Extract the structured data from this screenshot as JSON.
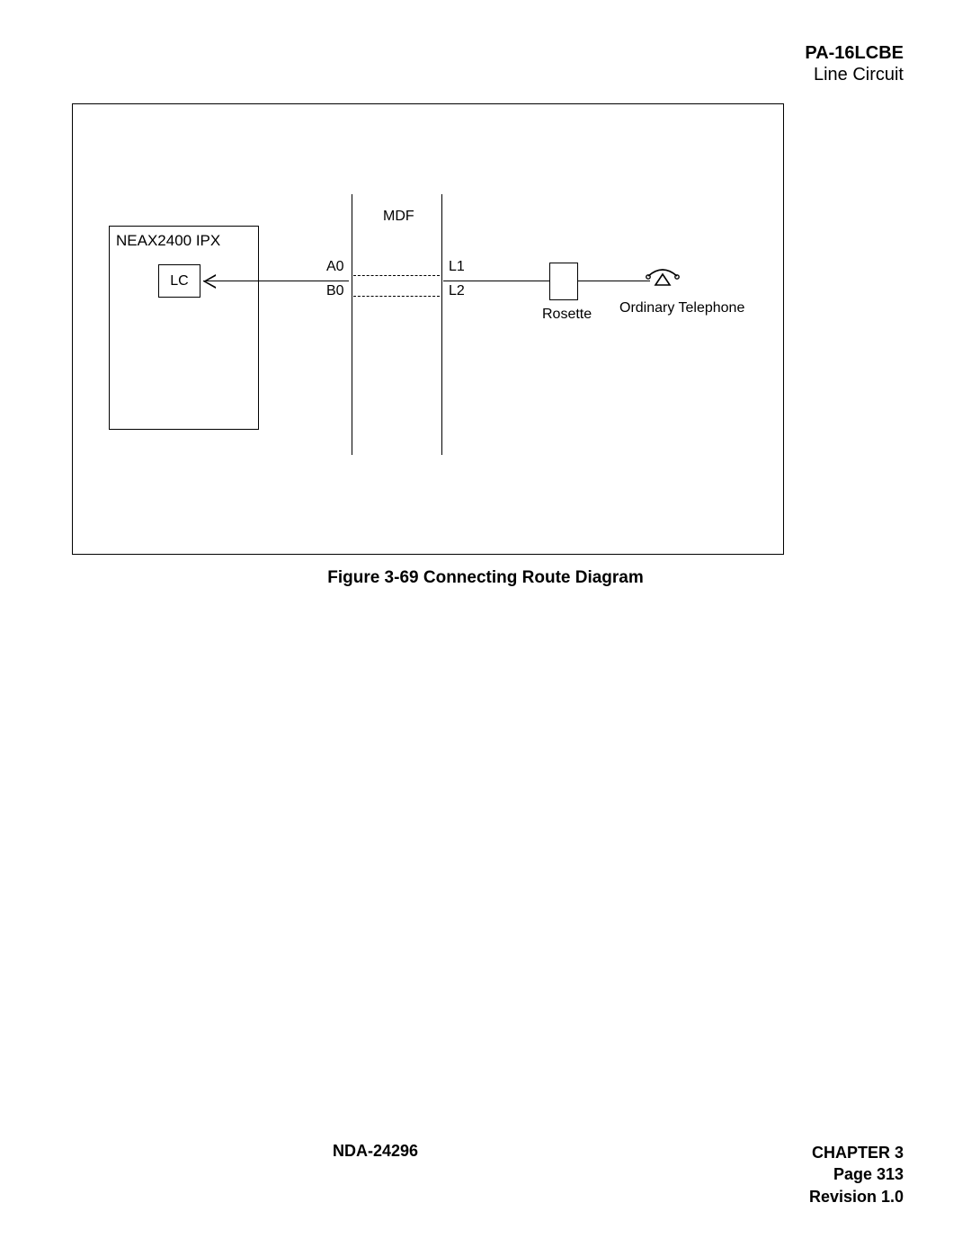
{
  "header": {
    "title": "PA-16LCBE",
    "subtitle": "Line Circuit"
  },
  "diagram": {
    "neax_label": "NEAX2400 IPX",
    "lc_label": "LC",
    "mdf_label": "MDF",
    "a0": "A0",
    "b0": "B0",
    "l1": "L1",
    "l2": "L2",
    "rosette_label": "Rosette",
    "phone_label": "Ordinary Telephone"
  },
  "caption": "Figure 3-69   Connecting Route Diagram",
  "footer": {
    "doc_id": "NDA-24296",
    "chapter": "CHAPTER 3",
    "page": "Page 313",
    "revision": "Revision 1.0"
  }
}
